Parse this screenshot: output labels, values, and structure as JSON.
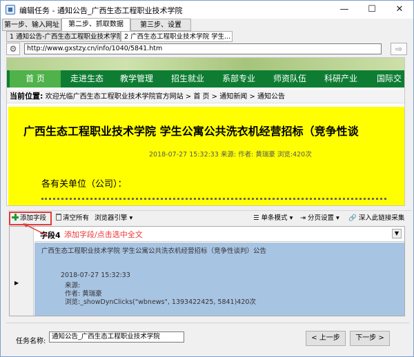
{
  "window": {
    "title": "编辑任务 - 通知公告_广西生态工程职业技术学院",
    "minimize": "—",
    "maximize": "☐",
    "close": "✕"
  },
  "steps": [
    {
      "label": "第一步、输入网址"
    },
    {
      "label": "第二步、抓取数据"
    },
    {
      "label": "第三步、设置"
    }
  ],
  "subtabs": [
    {
      "label": "1 通知公告-广西生态工程职业技术学院"
    },
    {
      "label": "2 广西生态工程职业技术学院 学生..."
    }
  ],
  "address": {
    "url": "http://www.gxstzy.cn/info/1040/5841.htm"
  },
  "site": {
    "nav": [
      "首 页",
      "走进生态",
      "教学管理",
      "招生就业",
      "系部专业",
      "师资队伍",
      "科研产业",
      "国际交"
    ],
    "breadcrumb_label": "当前位置:",
    "breadcrumb": "欢迎光临广西生态工程职业技术学院官方网站 > 首 页 > 通知新闻 > 通知公告",
    "article_title": "广西生态工程职业技术学院  学生公寓公共洗衣机经营招标（竞争性谈",
    "article_meta": "2018-07-27 15:32:33  来源:     作者: 黄瑞豪   浏览:420次",
    "article_body": "各有关单位（公司）："
  },
  "toolbar": {
    "add_field": "添加字段",
    "clear_all": "清空所有",
    "browser_engine": "浏览器引擎 ▾",
    "single_mode": "单条模式 ▾",
    "pagination": "分页设置 ▾",
    "deep_crawl": "深入此链接采集"
  },
  "grid": {
    "field_name": "字段4",
    "hint": "添加字段/点击选中全文",
    "cell_lines": [
      "广西生态工程职业技术学院 学生公寓公共洗衣机经营招标（竞争性谈判）公告",
      "2018-07-27 15:32:33",
      "来源:",
      "作者: 黄瑞豪",
      "浏览:_showDynClicks(\"wbnews\", 1393422425, 5841)420次"
    ]
  },
  "footer": {
    "task_label": "任务名称:",
    "task_value": "通知公告_广西生态工程职业技术学院",
    "prev": "< 上一步",
    "next": "下一步 >"
  },
  "colors": {
    "nav_green": "#0e7d33",
    "home_green": "#4fb24a",
    "article_yellow": "#ffff00",
    "selection_blue": "#a8c4e3",
    "callout_red": "#e23a3a"
  }
}
